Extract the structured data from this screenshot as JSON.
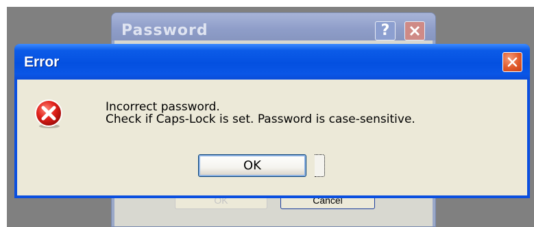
{
  "background_dialog": {
    "title": "Password",
    "help_label": "?",
    "ok_label": "OK",
    "cancel_label": "Cancel"
  },
  "error_dialog": {
    "title": "Error",
    "message_line1": "Incorrect password.",
    "message_line2": "Check if Caps-Lock is set. Password is case-sensitive.",
    "ok_label": "OK",
    "icon": "error-icon"
  },
  "colors": {
    "titlebar_blue": "#0450e0",
    "client_bg": "#ece9d8",
    "close_red": "#e05a2a",
    "error_red": "#e0201a"
  }
}
